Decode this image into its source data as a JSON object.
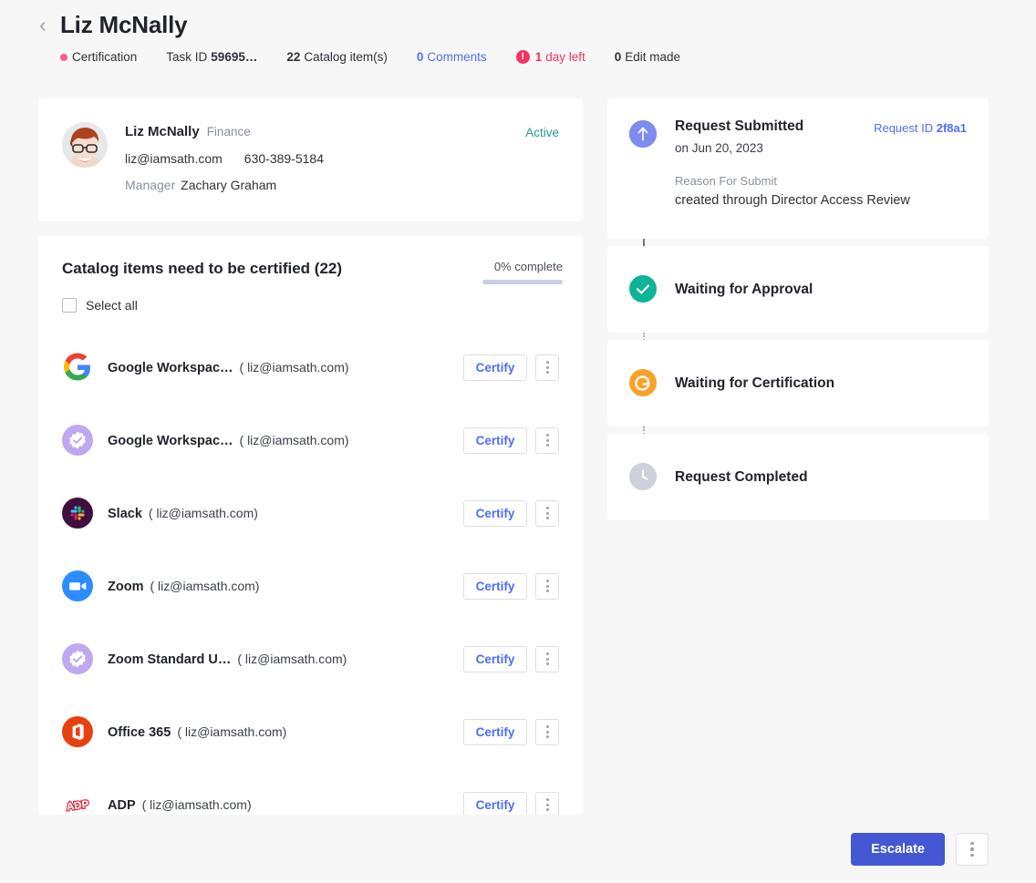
{
  "header": {
    "back_icon": "chevron-left-icon",
    "title": "Liz McNally",
    "meta": {
      "type_label": "Certification",
      "type_dot_color": "#fb5a8a",
      "task_id_label": "Task ID",
      "task_id_value": "59695…",
      "catalog_count": "22",
      "catalog_label": "Catalog item(s)",
      "comments_count": "0",
      "comments_label": "Comments",
      "due_count": "1",
      "due_label": "day left",
      "edits_count": "0",
      "edits_label": "Edit made"
    }
  },
  "profile": {
    "avatar": "user-avatar-photo",
    "name": "Liz McNally",
    "department": "Finance",
    "email": "liz@iamsath.com",
    "phone": "630-389-5184",
    "manager_label": "Manager",
    "manager_name": "Zachary Graham",
    "status": "Active",
    "status_color": "#1f9d8f"
  },
  "catalog": {
    "title": "Catalog items need to be certified (22)",
    "progress_label": "0% complete",
    "progress_percent": 0,
    "select_all_label": "Select all",
    "certify_label": "Certify",
    "items": [
      {
        "icon": "google-workspace-icon",
        "name": "Google Workspac…",
        "email": "( liz@iamsath.com)"
      },
      {
        "icon": "certification-badge-icon",
        "name": "Google Workspac…",
        "email": "( liz@iamsath.com)"
      },
      {
        "icon": "slack-icon",
        "name": "Slack",
        "email": "( liz@iamsath.com)"
      },
      {
        "icon": "zoom-icon",
        "name": "Zoom",
        "email": "( liz@iamsath.com)"
      },
      {
        "icon": "certification-badge-icon",
        "name": "Zoom Standard U…",
        "email": "( liz@iamsath.com)"
      },
      {
        "icon": "office365-icon",
        "name": "Office 365",
        "email": "( liz@iamsath.com)"
      },
      {
        "icon": "adp-icon",
        "name": "ADP",
        "email": "( liz@iamsath.com)"
      }
    ]
  },
  "timeline": {
    "submitted": {
      "badge": "arrow-up-icon",
      "title": "Request Submitted",
      "date": "on Jun 20, 2023",
      "request_id_label": "Request ID",
      "request_id_value": "2f8a1",
      "reason_label": "Reason For Submit",
      "reason_value": "created through Director Access Review"
    },
    "steps": [
      {
        "badge": "check-circle-icon",
        "title": "Waiting for Approval",
        "state": "done",
        "color": "#0fb397"
      },
      {
        "badge": "refresh-circle-icon",
        "title": "Waiting for Certification",
        "state": "active",
        "color": "#f9a228"
      },
      {
        "badge": "clock-circle-icon",
        "title": "Request Completed",
        "state": "pending",
        "color": "#ccd1dc"
      }
    ]
  },
  "footer": {
    "escalate_label": "Escalate",
    "escalate_color": "#4457d4",
    "more_icon": "kebab-menu-icon"
  }
}
